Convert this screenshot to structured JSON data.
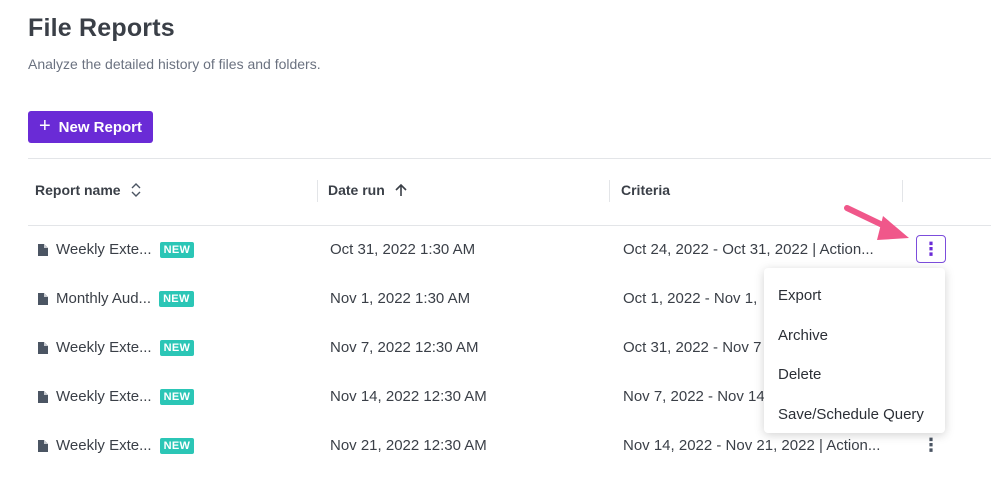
{
  "header": {
    "title": "File Reports",
    "subtitle": "Analyze the detailed history of files and folders."
  },
  "toolbar": {
    "new_report_label": "New Report",
    "plus_icon": "+"
  },
  "table": {
    "columns": [
      {
        "label": "Report name",
        "icon": "sort-icon"
      },
      {
        "label": "Date run",
        "icon": "arrow-up-icon"
      },
      {
        "label": "Criteria",
        "icon": ""
      }
    ],
    "rows": [
      {
        "name": "Weekly Exte...",
        "badge": "NEW",
        "date": "Oct 31, 2022 1:30 AM",
        "criteria": "Oct 24, 2022 - Oct 31, 2022 | Action..."
      },
      {
        "name": "Monthly Aud...",
        "badge": "NEW",
        "date": "Nov 1, 2022 1:30 AM",
        "criteria": "Oct 1, 2022 - Nov 1,"
      },
      {
        "name": "Weekly Exte...",
        "badge": "NEW",
        "date": "Nov 7, 2022 12:30 AM",
        "criteria": "Oct 31, 2022 - Nov 7"
      },
      {
        "name": "Weekly Exte...",
        "badge": "NEW",
        "date": "Nov 14, 2022 12:30 AM",
        "criteria": "Nov 7, 2022 - Nov 14"
      },
      {
        "name": "Weekly Exte...",
        "badge": "NEW",
        "date": "Nov 21, 2022 12:30 AM",
        "criteria": "Nov 14, 2022 - Nov 21, 2022 | Action..."
      }
    ]
  },
  "row_menu": {
    "items": [
      "Export",
      "Archive",
      "Delete",
      "Save/Schedule Query"
    ]
  },
  "kebab_glyph": "⋮",
  "colors": {
    "accent": "#6a2bd6",
    "badge": "#2bc6b6",
    "annotation_arrow": "#f0578a"
  }
}
